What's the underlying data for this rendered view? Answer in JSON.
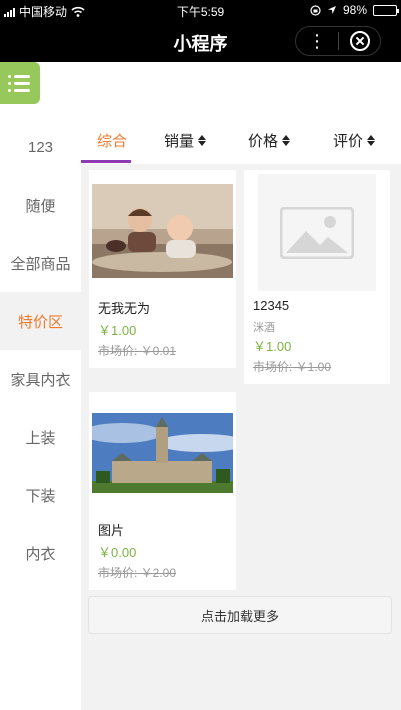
{
  "status_bar": {
    "carrier": "中国移动",
    "time": "下午5:59",
    "battery": "98%",
    "battery_level_percent": 98
  },
  "nav": {
    "title": "小程序",
    "more_glyph": "⋮"
  },
  "sidebar": {
    "items": [
      {
        "label": "123",
        "active": false
      },
      {
        "label": "随便",
        "active": false
      },
      {
        "label": "全部商品",
        "active": false
      },
      {
        "label": "特价区",
        "active": true
      },
      {
        "label": "家具内衣",
        "active": false
      },
      {
        "label": "上装",
        "active": false
      },
      {
        "label": "下装",
        "active": false
      },
      {
        "label": "内衣",
        "active": false
      }
    ]
  },
  "tabs": [
    {
      "label": "综合",
      "active": true,
      "sortable": false
    },
    {
      "label": "销量",
      "active": false,
      "sortable": true
    },
    {
      "label": "价格",
      "active": false,
      "sortable": true
    },
    {
      "label": "评价",
      "active": false,
      "sortable": true
    }
  ],
  "products": [
    {
      "name": "无我无为",
      "subtitle": "",
      "price": "￥1.00",
      "market_price": "市场价: ￥0.01",
      "image": "kids-photo"
    },
    {
      "name": "12345",
      "subtitle": "洣酒",
      "price": "￥1.00",
      "market_price": "市场价: ￥1.00",
      "image": "placeholder-image-icon"
    },
    {
      "name": "图片",
      "subtitle": "",
      "price": "￥0.00",
      "market_price": "市场价: ￥2.00",
      "image": "parliament-photo"
    }
  ],
  "load_more": "点击加载更多",
  "colors": {
    "accent_orange": "#f07b2e",
    "price_green": "#7cb342",
    "tab_underline": "#8e3ab4",
    "menu_green": "#8bc34a"
  }
}
